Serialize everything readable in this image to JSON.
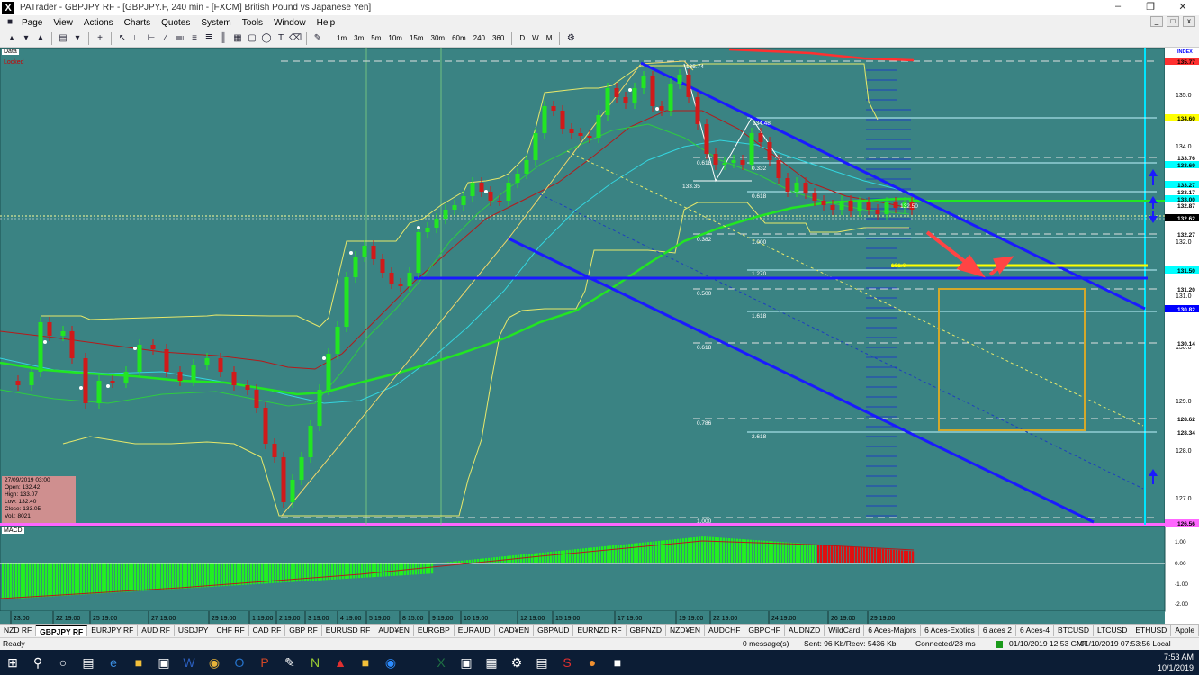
{
  "window": {
    "title": "PATrader - GBPJPY RF - [GBPJPY.F, 240 min - [FXCM] British Pound vs Japanese Yen]",
    "icon_letter": "X"
  },
  "menu": [
    "Page",
    "View",
    "Actions",
    "Charts",
    "Quotes",
    "System",
    "Tools",
    "Window",
    "Help"
  ],
  "toolbar": {
    "timeframes": [
      "1m",
      "3m",
      "5m",
      "10m",
      "15m",
      "30m",
      "60m",
      "240",
      "360",
      "D",
      "W",
      "M"
    ]
  },
  "chart": {
    "data_label": "Data",
    "locked_label": "Locked",
    "index_label": "INDEX",
    "macd_label": "MACD",
    "info_box": {
      "date": "27/09/2019 03:00",
      "open": "Open: 132.42",
      "high": "High: 133.07",
      "low": "Low: 132.40",
      "close": "Close: 133.05",
      "vol": "Vol.: 8021"
    },
    "price_axis": [
      "135.0",
      "134.0",
      "133.0",
      "132.0",
      "131.0",
      "130.0",
      "129.0",
      "128.0",
      "127.0"
    ],
    "price_tags": [
      {
        "label": "135.77",
        "color": "#ff3030",
        "text_color": "#000"
      },
      {
        "label": "134.60",
        "color": "#ffff00",
        "text_color": "#000"
      },
      {
        "label": "133.76",
        "color": "#ffffff",
        "text_color": "#000"
      },
      {
        "label": "133.69",
        "color": "#00ffff",
        "text_color": "#000"
      },
      {
        "label": "133.27",
        "color": "#00ffff",
        "text_color": "#000"
      },
      {
        "label": "133.17",
        "color": "#ffffff",
        "text_color": "#000"
      },
      {
        "label": "133.00",
        "color": "#00ffff",
        "text_color": "#000"
      },
      {
        "label": "132.87",
        "color": "#ffffff",
        "text_color": "#000"
      },
      {
        "label": "132.62",
        "color": "#000000",
        "text_color": "#fff"
      },
      {
        "label": "132.27",
        "color": "#ffffff",
        "text_color": "#000"
      },
      {
        "label": "131.50",
        "color": "#00ffff",
        "text_color": "#000"
      },
      {
        "label": "131.20",
        "color": "#ffffff",
        "text_color": "#000"
      },
      {
        "label": "130.82",
        "color": "#0000ff",
        "text_color": "#fff"
      },
      {
        "label": "130.14",
        "color": "#ffffff",
        "text_color": "#000"
      },
      {
        "label": "128.62",
        "color": "#ffffff",
        "text_color": "#000"
      },
      {
        "label": "128.34",
        "color": "#ffffff",
        "text_color": "#000"
      },
      {
        "label": "126.56",
        "color": "#ff66ff",
        "text_color": "#000"
      }
    ],
    "fib_labels": [
      "0.382",
      "0.500",
      "0.618",
      "0.786",
      "1.000",
      "0.618",
      "1.000",
      "1.270",
      "1.618",
      "2.618",
      "0.332",
      "0.618"
    ],
    "point_labels": [
      "135.74",
      "133.35",
      "134.48",
      "131.6",
      "132.50"
    ],
    "macd_axis": [
      "1.00",
      "0.00",
      "-1.00",
      "-2.00"
    ],
    "time_axis": [
      "23:00",
      "22 19:00",
      "25 19:00",
      "27 19:00",
      "29 19:00",
      "1 19:00",
      "2 19:00",
      "3 19:00",
      "4 19:00",
      "5 19:00",
      "8 15:00",
      "9 19:00",
      "10 19:00",
      "12 19:00",
      "15 19:00",
      "17 19:00",
      "19 19:00",
      "22 19:00",
      "24 19:00",
      "26 19:00",
      "29 19:00"
    ]
  },
  "tabs": [
    "NZD RF",
    "GBPJPY RF",
    "EURJPY RF",
    "AUD RF",
    "USDJPY",
    "CHF RF",
    "CAD RF",
    "GBP RF",
    "EURUSD RF",
    "AUD¥EN",
    "EURGBP",
    "EURAUD",
    "CAD¥EN",
    "GBPAUD",
    "EURNZD RF",
    "GBPNZD",
    "NZD¥EN",
    "AUDCHF",
    "GBPCHF",
    "AUDNZD",
    "WildCard",
    "6 Aces-Majors",
    "6 Aces-Exotics",
    "6 aces 2",
    "6 Aces-4",
    "BTCUSD",
    "LTCUSD",
    "ETHUSD",
    "Apple"
  ],
  "active_tab": "GBPJPY RF",
  "status": {
    "ready": "Ready",
    "messages": "0 message(s)",
    "traffic": "Sent: 96 Kb/Recv: 5436 Kb",
    "connection": "Connected/28 ms",
    "server_time": "01/10/2019 12:53 GMT",
    "local_time": "01/10/2019 07:53:56 Local"
  },
  "taskbar": {
    "time": "7:53 AM",
    "date": "10/1/2019"
  }
}
